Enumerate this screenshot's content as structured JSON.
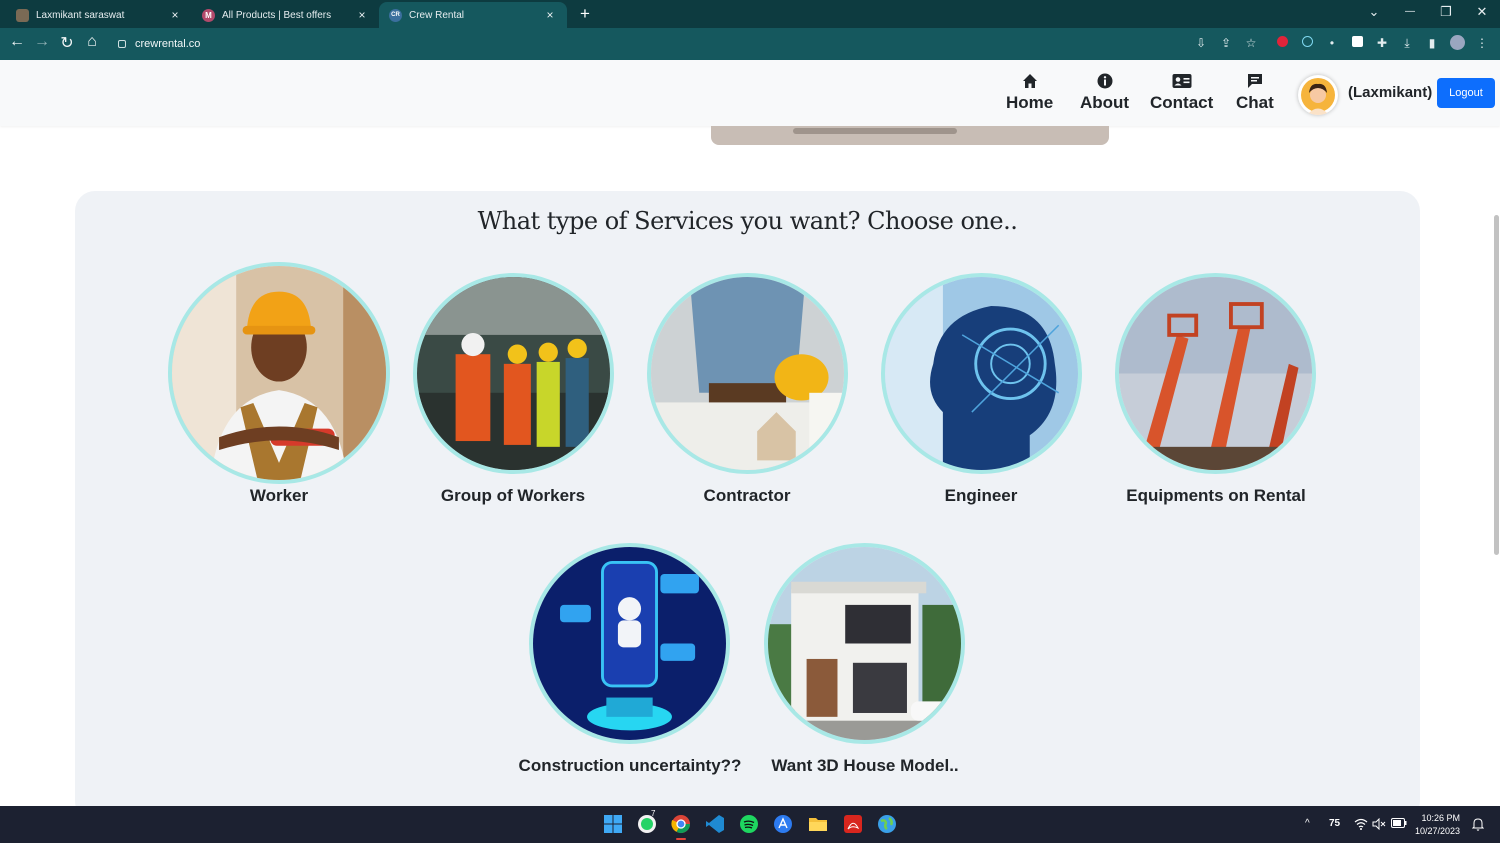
{
  "browser": {
    "tabs": [
      {
        "title": "Laxmikant saraswat",
        "close": "×"
      },
      {
        "title": "All Products | Best offers",
        "close": "×",
        "favicon_letter": "M"
      },
      {
        "title": "Crew Rental",
        "close": "×",
        "favicon_letter": "CR"
      }
    ],
    "new_tab": "+",
    "window_controls": {
      "tab_search": "⌄",
      "minimize": "—",
      "restore": "❐",
      "close": "✕"
    },
    "nav": {
      "back": "←",
      "forward": "→",
      "reload": "↻",
      "home": "⌂"
    },
    "url": "crewrental.co",
    "toolbar_icons": [
      "install-icon",
      "share-icon",
      "star-icon",
      "extension-red-icon",
      "extension-react-icon",
      "extension-pin-icon",
      "extension-square-icon",
      "puzzle-icon",
      "download-icon",
      "sidepanel-icon",
      "profile-icon",
      "menu-icon"
    ]
  },
  "header": {
    "nav": [
      {
        "label": "Home",
        "icon": "home-icon"
      },
      {
        "label": "About",
        "icon": "info-icon"
      },
      {
        "label": "Contact",
        "icon": "contact-card-icon"
      },
      {
        "label": "Chat",
        "icon": "chat-icon"
      }
    ],
    "user_name": "(Laxmikant)",
    "logout": "Logout"
  },
  "services": {
    "title": "What type of Services you want? Choose one..",
    "items": [
      {
        "label": "Worker"
      },
      {
        "label": "Group of Workers"
      },
      {
        "label": "Contractor"
      },
      {
        "label": "Engineer"
      },
      {
        "label": "Equipments on Rental"
      },
      {
        "label": "Construction uncertainty??"
      },
      {
        "label": "Want 3D House Model.."
      }
    ]
  },
  "taskbar": {
    "apps": [
      "windows-start-icon",
      "whatsapp-icon",
      "chrome-icon",
      "vscode-icon",
      "spotify-icon",
      "app-store-icon",
      "file-explorer-icon",
      "acrobat-icon",
      "earth-icon"
    ],
    "whatsapp_badge": "7",
    "tray": {
      "chevron": "^",
      "temperature": "75",
      "wifi": "wifi-icon",
      "volume": "volume-mute-icon",
      "battery": "battery-icon"
    },
    "time": "10:26 PM",
    "date": "10/27/2023"
  },
  "colors": {
    "tabstrip": "#0d3b40",
    "toolbar": "#15585e",
    "section_bg": "#eff2f6",
    "circle_border": "#a8e8e6",
    "logout": "#0d6efd",
    "taskbar": "#1c2131"
  }
}
